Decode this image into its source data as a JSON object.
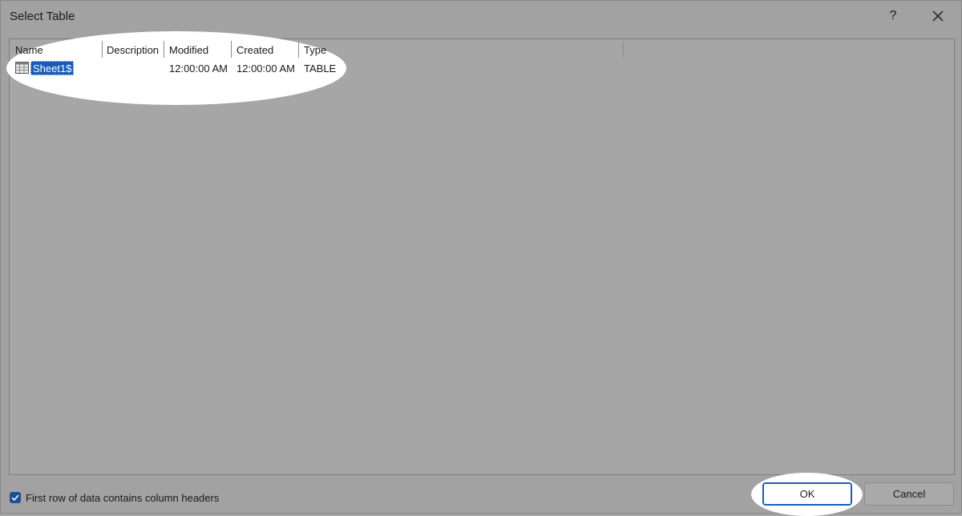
{
  "window": {
    "title": "Select Table",
    "help_label": "?"
  },
  "columns": [
    {
      "label": "Name"
    },
    {
      "label": "Description"
    },
    {
      "label": "Modified"
    },
    {
      "label": "Created"
    },
    {
      "label": "Type"
    }
  ],
  "rows": [
    {
      "name": "Sheet1$",
      "description": "",
      "modified": "12:00:00 AM",
      "created": "12:00:00 AM",
      "type": "TABLE",
      "icon": "table-icon",
      "selected": true
    }
  ],
  "footer": {
    "checkbox_label": "First row of data contains column headers",
    "checkbox_checked": true,
    "ok_label": "OK",
    "cancel_label": "Cancel"
  },
  "colors": {
    "selection": "#1b5bb5",
    "checkbox": "#1c4f96",
    "dimmed_background": "#a2a2a2"
  }
}
